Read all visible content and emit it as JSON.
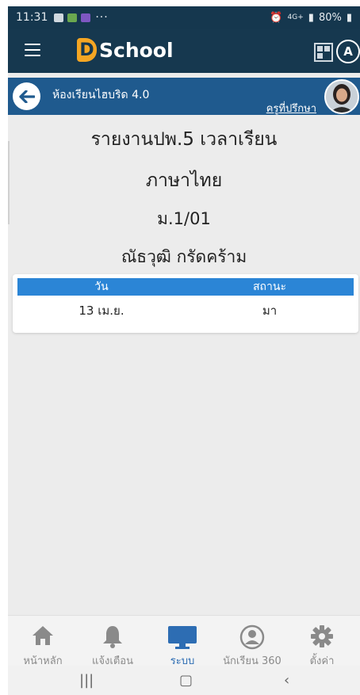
{
  "status_bar": {
    "time": "11:31",
    "dots": "···",
    "network": "4G+",
    "battery": "80%"
  },
  "app": {
    "logo_letter": "D",
    "logo_text": "School",
    "scanner_icon": "qr-code-icon",
    "profile_letter": "A"
  },
  "subheader": {
    "title": "ห้องเรียนไฮบริด 4.0",
    "role": "ครูที่ปรึกษา"
  },
  "report": {
    "title": "รายงานปพ.5 เวลาเรียน",
    "subject": "ภาษาไทย",
    "class": "ม.1/01",
    "student": "ณัธวุฒิ กรัดคร้าม"
  },
  "table": {
    "headers": [
      "วัน",
      "สถานะ"
    ],
    "rows": [
      [
        "13 เม.ย.",
        "มา"
      ]
    ]
  },
  "bottom_nav": [
    {
      "label": "หน้าหลัก",
      "icon": "home-icon"
    },
    {
      "label": "แจ้งเตือน",
      "icon": "bell-icon"
    },
    {
      "label": "ระบบ",
      "icon": "monitor-icon"
    },
    {
      "label": "นักเรียน 360",
      "icon": "user-circle-icon"
    },
    {
      "label": "ตั้งค่า",
      "icon": "gear-icon"
    }
  ],
  "colors": {
    "app_bar": "#16384f",
    "sub_header": "#1f5a8e",
    "table_header": "#2b85d6",
    "active_nav": "#2d6db3",
    "logo_accent": "#f5a623"
  }
}
